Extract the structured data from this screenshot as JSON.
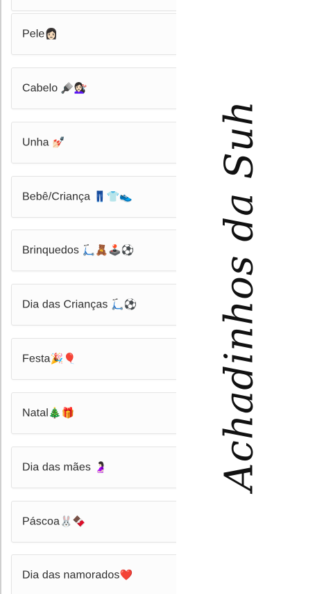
{
  "categories": [
    {
      "label": "Pele",
      "emoji": "👩🏻"
    },
    {
      "label": "Cabelo ",
      "emoji": "🪮💇🏻‍♀️"
    },
    {
      "label": "Unha ",
      "emoji": "💅🏻"
    },
    {
      "label": "Bebê/Criança ",
      "emoji": "👖👕👟"
    },
    {
      "label": "Brinquedos ",
      "emoji": "🛴🧸🕹️⚽"
    },
    {
      "label": "Dia das Crianças ",
      "emoji": "🛴⚽"
    },
    {
      "label": "Festa",
      "emoji": "🎉🎈"
    },
    {
      "label": "Natal",
      "emoji": "🎄🎁"
    },
    {
      "label": "Dia das mães ",
      "emoji": "🤰🏻"
    },
    {
      "label": "Páscoa",
      "emoji": "🐰🍫"
    },
    {
      "label": "Dia das namorados",
      "emoji": "❤️"
    }
  ],
  "brand": {
    "title": "Achadinhos da Suh"
  }
}
